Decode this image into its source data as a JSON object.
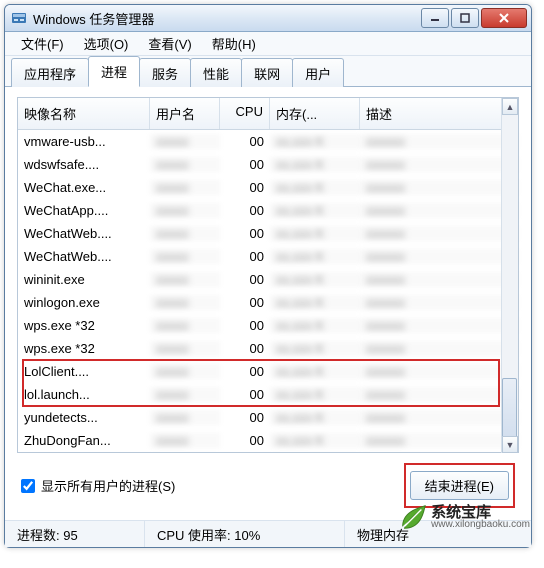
{
  "window": {
    "title": "Windows 任务管理器",
    "buttons": {
      "close": "×"
    }
  },
  "menu": [
    "文件(F)",
    "选项(O)",
    "查看(V)",
    "帮助(H)"
  ],
  "tabs": [
    "应用程序",
    "进程",
    "服务",
    "性能",
    "联网",
    "用户"
  ],
  "active_tab": 1,
  "columns": {
    "name": "映像名称",
    "user": "用户名",
    "cpu": "CPU",
    "mem": "内存(...",
    "desc": "描述"
  },
  "rows": [
    {
      "name": "vmware-usb...",
      "cpu": "00"
    },
    {
      "name": "wdswfsafe....",
      "cpu": "00"
    },
    {
      "name": "WeChat.exe...",
      "cpu": "00"
    },
    {
      "name": "WeChatApp....",
      "cpu": "00"
    },
    {
      "name": "WeChatWeb....",
      "cpu": "00"
    },
    {
      "name": "WeChatWeb....",
      "cpu": "00"
    },
    {
      "name": "wininit.exe",
      "cpu": "00"
    },
    {
      "name": "winlogon.exe",
      "cpu": "00"
    },
    {
      "name": "wps.exe *32",
      "cpu": "00"
    },
    {
      "name": "wps.exe *32",
      "cpu": "00"
    },
    {
      "name": "LolClient....",
      "cpu": "00"
    },
    {
      "name": "lol.launch...",
      "cpu": "00"
    },
    {
      "name": "yundetects...",
      "cpu": "00"
    },
    {
      "name": "ZhuDongFan...",
      "cpu": "00"
    }
  ],
  "highlight_red_rows": {
    "start": 10,
    "end": 11
  },
  "show_all_users": {
    "checked": true,
    "label": "显示所有用户的进程(S)"
  },
  "end_process_button": "结束进程(E)",
  "status": {
    "processes": "进程数: 95",
    "cpu": "CPU 使用率: 10%",
    "mem": "物理内存"
  },
  "watermark": {
    "name": "系统宝库",
    "url": "www.xilongbaoku.com"
  }
}
